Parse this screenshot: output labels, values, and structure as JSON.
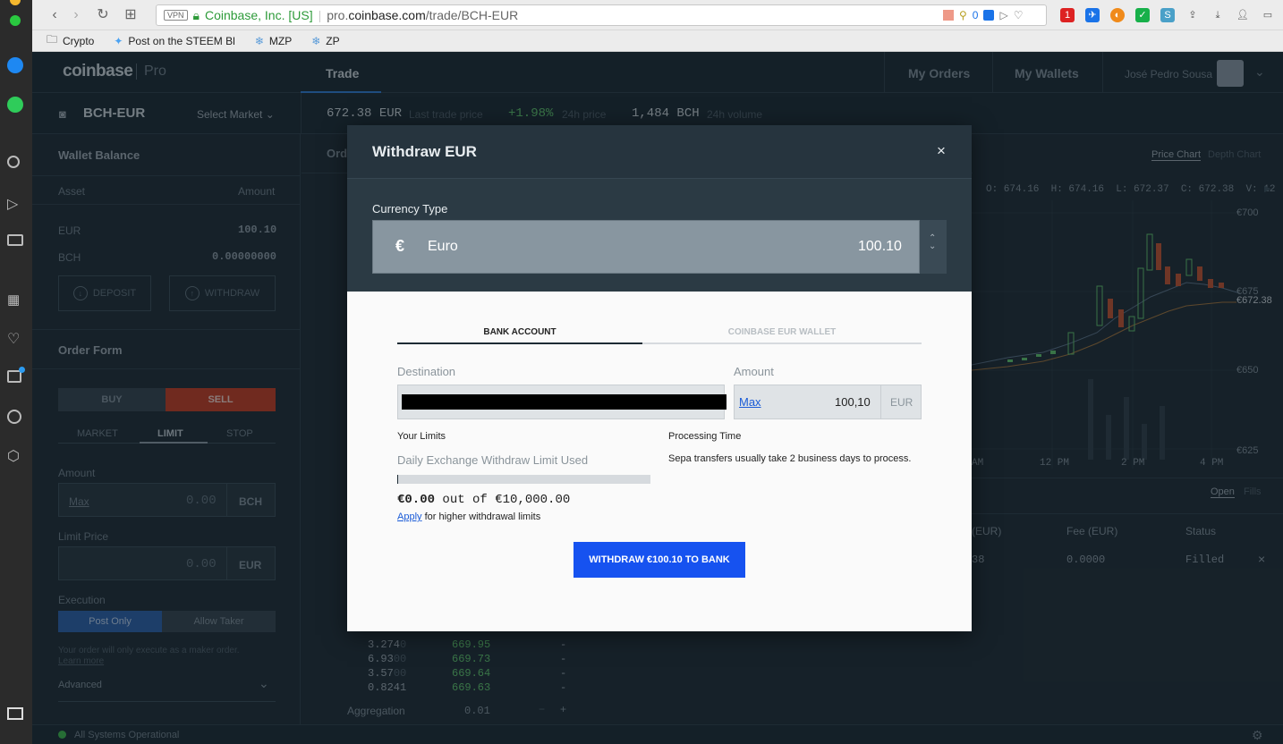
{
  "browser": {
    "vpn": "VPN",
    "org": "Coinbase, Inc. [US]",
    "url_prefix": "pro.",
    "url_domain": "coinbase.com",
    "url_path": "/trade/BCH-EUR",
    "ext_count": "0",
    "bookmarks": [
      "Crypto",
      "Post on the STEEM Bl",
      "MZP",
      "ZP"
    ]
  },
  "nav": {
    "logo": "coinbase",
    "logo_sub": "Pro",
    "trade": "Trade",
    "my_orders": "My Orders",
    "my_wallets": "My Wallets",
    "user": "José Pedro Sousa"
  },
  "market": {
    "pair": "BCH-EUR",
    "select": "Select Market",
    "last_price": "672.38",
    "last_price_unit": "EUR",
    "last_price_label": "Last trade price",
    "change": "+1.98%",
    "change_label": "24h price",
    "volume": "1,484",
    "volume_unit": "BCH",
    "volume_label": "24h volume"
  },
  "wallet": {
    "title": "Wallet Balance",
    "col_asset": "Asset",
    "col_amount": "Amount",
    "rows": [
      {
        "asset": "EUR",
        "amount": "100.10"
      },
      {
        "asset": "BCH",
        "amount": "0.00000000"
      }
    ],
    "deposit": "DEPOSIT",
    "withdraw": "WITHDRAW"
  },
  "order_form": {
    "title": "Order Form",
    "buy": "BUY",
    "sell": "SELL",
    "market": "MARKET",
    "limit": "LIMIT",
    "stop": "STOP",
    "amount_label": "Amount",
    "max": "Max",
    "amount_value": "0.00",
    "amount_unit": "BCH",
    "limit_label": "Limit Price",
    "limit_value": "0.00",
    "limit_unit": "EUR",
    "execution_label": "Execution",
    "post_only": "Post Only",
    "allow_taker": "Allow Taker",
    "note": "Your order will only execute as a maker order.",
    "learn_more": "Learn more",
    "advanced": "Advanced"
  },
  "chart": {
    "tab_price": "Price Chart",
    "tab_depth": "Depth Chart",
    "ohlc": "O: 674.16  H: 674.16  L: 672.37  C: 672.38  V: 12",
    "y_labels": [
      "€700",
      "€675",
      "€672.38",
      "€650",
      "€625"
    ],
    "x_labels": [
      "AM",
      "12 PM",
      "2 PM",
      "4 PM"
    ]
  },
  "orders": {
    "tab_open": "Open",
    "tab_fills": "Fills",
    "col_price": "(EUR)",
    "col_fee": "Fee (EUR)",
    "col_status": "Status",
    "row": {
      "price": "38",
      "fee": "0.0000",
      "status": "Filled"
    }
  },
  "orderbook": {
    "rows": [
      {
        "size": "3.274",
        "size_dim": "0",
        "price": "669.95",
        "mine": "-"
      },
      {
        "size": "6.93",
        "size_dim": "00",
        "price": "669.73",
        "mine": "-"
      },
      {
        "size": "3.57",
        "size_dim": "00",
        "price": "669.64",
        "mine": "-"
      },
      {
        "size": "0.8241",
        "size_dim": "",
        "price": "669.63",
        "mine": "-"
      }
    ],
    "aggregation_label": "Aggregation",
    "aggregation_value": "0.01"
  },
  "order_tab_partial": "Ord",
  "status_bar": {
    "text": "All Systems Operational"
  },
  "modal": {
    "title": "Withdraw EUR",
    "close": "×",
    "currency_label": "Currency Type",
    "currency_symbol": "€",
    "currency_name": "Euro",
    "currency_amount": "100.10",
    "tab_bank": "BANK ACCOUNT",
    "tab_wallet": "COINBASE EUR WALLET",
    "destination_label": "Destination",
    "amount_label": "Amount",
    "max": "Max",
    "amount_value": "100,10",
    "amount_unit": "EUR",
    "limits_label": "Your Limits",
    "processing_label": "Processing Time",
    "daily_limit_label": "Daily Exchange Withdraw Limit Used",
    "limit_used": "€0.00",
    "limit_out_of": "out of",
    "limit_total": "€10,000.00",
    "limit_fraction": 0,
    "apply": "Apply",
    "apply_suffix": "for higher withdrawal limits",
    "processing_text": "Sepa transfers usually take 2 business days to process.",
    "submit": "WITHDRAW €100.10 TO BANK"
  },
  "colors": {
    "accent_blue": "#1652f0",
    "sell_red": "#c23b22",
    "positive_green": "#5ec26a",
    "post_only_blue": "#2b5fa8"
  }
}
